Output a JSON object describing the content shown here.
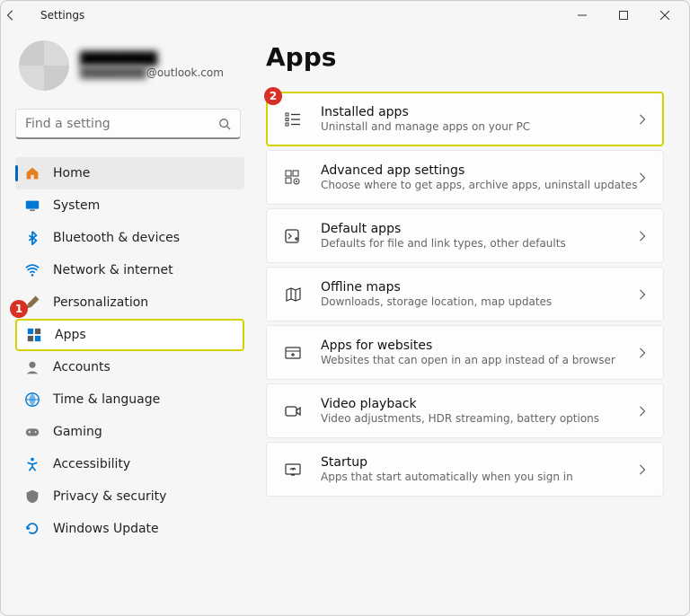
{
  "window": {
    "title": "Settings"
  },
  "user": {
    "name": "████████",
    "email_blur": "████████",
    "email_suffix": "@outlook.com"
  },
  "search": {
    "placeholder": "Find a setting"
  },
  "sidebar": {
    "items": [
      {
        "label": "Home"
      },
      {
        "label": "System"
      },
      {
        "label": "Bluetooth & devices"
      },
      {
        "label": "Network & internet"
      },
      {
        "label": "Personalization"
      },
      {
        "label": "Apps"
      },
      {
        "label": "Accounts"
      },
      {
        "label": "Time & language"
      },
      {
        "label": "Gaming"
      },
      {
        "label": "Accessibility"
      },
      {
        "label": "Privacy & security"
      },
      {
        "label": "Windows Update"
      }
    ]
  },
  "page": {
    "title": "Apps"
  },
  "cards": [
    {
      "title": "Installed apps",
      "sub": "Uninstall and manage apps on your PC"
    },
    {
      "title": "Advanced app settings",
      "sub": "Choose where to get apps, archive apps, uninstall updates"
    },
    {
      "title": "Default apps",
      "sub": "Defaults for file and link types, other defaults"
    },
    {
      "title": "Offline maps",
      "sub": "Downloads, storage location, map updates"
    },
    {
      "title": "Apps for websites",
      "sub": "Websites that can open in an app instead of a browser"
    },
    {
      "title": "Video playback",
      "sub": "Video adjustments, HDR streaming, battery options"
    },
    {
      "title": "Startup",
      "sub": "Apps that start automatically when you sign in"
    }
  ],
  "annotations": {
    "badge1": "1",
    "badge2": "2"
  }
}
